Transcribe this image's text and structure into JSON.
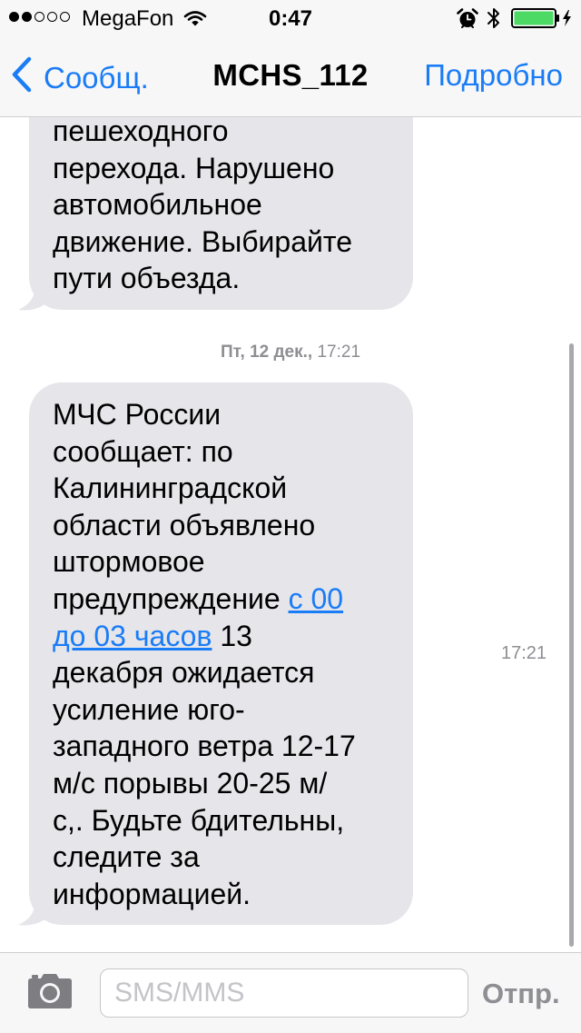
{
  "status_bar": {
    "carrier": "MegaFon",
    "time": "0:47",
    "signal_bars_filled": 2,
    "signal_bars_total": 5,
    "battery_level_percent": 100,
    "icons": [
      "wifi-icon",
      "alarm-icon",
      "bluetooth-icon",
      "battery-icon",
      "charging-icon"
    ]
  },
  "nav": {
    "back_label": "Сообщ.",
    "title": "MCHS_112",
    "details_label": "Подробно"
  },
  "conversation": {
    "message_1": {
      "lines": [
        "пешеходного",
        "перехода. Нарушено",
        "автомобильное",
        "движение.  Выбирайте",
        "пути объезда."
      ]
    },
    "timestamp": {
      "date": "Пт, 12 дек.,",
      "time": "17:21"
    },
    "message_2": {
      "line_1": "МЧС России",
      "line_2": "сообщает: по",
      "line_3": "Калининградской",
      "line_4": "области объявлено",
      "line_5": "штормовое",
      "line_6_text": "предупреждение ",
      "link_part_1": "с 00",
      "link_part_2": "до 03 часов",
      "line_7_after": " 13",
      "line_8": "декабря ожидается",
      "line_9": "усиление юго-",
      "line_10": "западного ветра 12-17",
      "line_11": "м/с порывы  20-25 м/",
      "line_12": "с,. Будьте бдительны,",
      "line_13": "следите за",
      "line_14": "информацией.",
      "time": "17:21"
    }
  },
  "input_bar": {
    "placeholder": "SMS/MMS",
    "value": "",
    "send_label": "Отпр."
  },
  "colors": {
    "accent": "#1a7cf6",
    "bubble_incoming": "#e5e5ea",
    "secondary_text": "#8e8e93",
    "battery": "#4cd964",
    "bar_background": "#f7f7f8"
  }
}
